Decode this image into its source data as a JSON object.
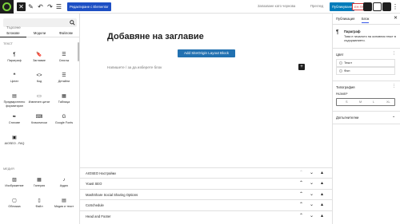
{
  "toolbar": {
    "close_icon": "close-icon",
    "tools": [
      "pencil-icon",
      "undo-icon",
      "redo-icon",
      "list-view-icon"
    ],
    "elementor_label": "Редактиране с Elementor",
    "save_draft_label": "Запазване като чернова",
    "preview_label": "Преглед",
    "publish_label": "Публикуване",
    "edit_badge": "ЕН ПР",
    "settings_icon": "settings-icon",
    "more_icon": "more-vertical-icon"
  },
  "inserter": {
    "search_placeholder": "Търсене",
    "tabs": [
      "Блокове",
      "Модели",
      "Файлове"
    ],
    "sections": {
      "text": "Текст",
      "media": "Медия"
    },
    "text_blocks": [
      {
        "label": "Параграф",
        "icon": "paragraph-icon",
        "glyph": "¶"
      },
      {
        "label": "Заглавие",
        "icon": "heading-icon",
        "glyph": "🔖"
      },
      {
        "label": "Списък",
        "icon": "list-icon",
        "glyph": "☰"
      },
      {
        "label": "Цитат",
        "icon": "quote-icon",
        "glyph": "❝"
      },
      {
        "label": "Код",
        "icon": "code-icon",
        "glyph": "<>"
      },
      {
        "label": "Детайли",
        "icon": "details-icon",
        "glyph": "☰"
      },
      {
        "label": "Предварително форматиран",
        "icon": "preformatted-icon",
        "glyph": "▤"
      },
      {
        "label": "Извлечен цитат",
        "icon": "pullquote-icon",
        "glyph": "▭"
      },
      {
        "label": "Таблица",
        "icon": "table-icon",
        "glyph": "▦"
      },
      {
        "label": "Стихове",
        "icon": "verse-icon",
        "glyph": "✒"
      },
      {
        "label": "Класически",
        "icon": "classic-icon",
        "glyph": "⌨"
      },
      {
        "label": "Google Fonts",
        "icon": "google-fonts-icon",
        "glyph": "G"
      },
      {
        "label": "AIOSEO - FAQ",
        "icon": "aioseo-faq-icon",
        "glyph": "▣"
      }
    ],
    "media_blocks": [
      {
        "label": "Изображение",
        "icon": "image-icon",
        "glyph": "▨"
      },
      {
        "label": "Галерия",
        "icon": "gallery-icon",
        "glyph": "▦"
      },
      {
        "label": "Аудио",
        "icon": "audio-icon",
        "glyph": "♪"
      },
      {
        "label": "Обложка",
        "icon": "cover-icon",
        "glyph": "▢"
      },
      {
        "label": "Файл",
        "icon": "file-icon",
        "glyph": "▯"
      },
      {
        "label": "Медия и текст",
        "icon": "media-text-icon",
        "glyph": "▤"
      }
    ]
  },
  "canvas": {
    "title_placeholder": "Добавяне на заглавие",
    "layout_button": "Add SiteOrigin Layout Block",
    "block_placeholder": "Напишете / за да изберете блок",
    "add_block_glyph": "+"
  },
  "metaboxes": [
    {
      "title": "AIOSEO Настройки",
      "up_dimmed": true
    },
    {
      "title": "Yoast SEO",
      "up_dimmed": false
    },
    {
      "title": "MashShare Social Sharing Options",
      "up_dimmed": false
    },
    {
      "title": "CoSchedule",
      "up_dimmed": false
    },
    {
      "title": "Head and Footer",
      "up_dimmed": false
    }
  ],
  "sidebar": {
    "tabs": [
      "Публикация",
      "Блок"
    ],
    "block_name": "Параграф",
    "block_description": "Това е началото на основния текст в съдържанието.",
    "color_heading": "Цвят",
    "color_items": [
      "Текст",
      "Фон"
    ],
    "typography_heading": "Типография",
    "size_label": "Размер",
    "size_options": [
      "S",
      "M",
      "L",
      "XL"
    ],
    "advanced_label": "Допълнителни",
    "colors": {
      "accent": "#3858e9",
      "publish": "#007cba",
      "elementor": "#1d4fc4"
    }
  }
}
